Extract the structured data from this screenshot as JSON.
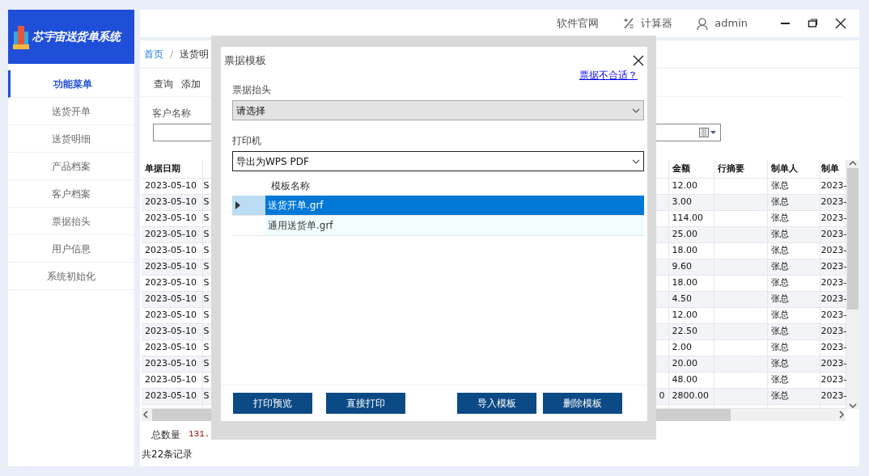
{
  "app": {
    "title": "芯宇宙送货单系统"
  },
  "sidebar": {
    "items": [
      {
        "label": "功能菜单",
        "selected": true
      },
      {
        "label": "送货开单",
        "selected": false
      },
      {
        "label": "送货明细",
        "selected": false
      },
      {
        "label": "产品档案",
        "selected": false
      },
      {
        "label": "客户档案",
        "selected": false
      },
      {
        "label": "票据抬头",
        "selected": false
      },
      {
        "label": "用户信息",
        "selected": false
      },
      {
        "label": "系统初始化",
        "selected": false
      }
    ]
  },
  "topbar": {
    "links": [
      {
        "kind": "plain",
        "label": "软件官网"
      },
      {
        "kind": "calculator",
        "label": "计算器"
      },
      {
        "kind": "user",
        "label": "admin"
      }
    ]
  },
  "breadcrumb": {
    "items": [
      "首页",
      "送货明"
    ],
    "separator": "/"
  },
  "toolbar": [
    "查询",
    "添加"
  ],
  "filter": {
    "label": "客户名称"
  },
  "table": {
    "columns": [
      "单据日期",
      null,
      null,
      "金额",
      "行摘要",
      "制单人",
      "制单"
    ],
    "rows": [
      [
        "2023-05-10",
        "S",
        null,
        "12.00",
        null,
        "张总",
        "2023-"
      ],
      [
        "2023-05-10",
        "S",
        null,
        "3.00",
        null,
        "张总",
        "2023-"
      ],
      [
        "2023-05-10",
        "S",
        null,
        "114.00",
        null,
        "张总",
        "2023-"
      ],
      [
        "2023-05-10",
        "S",
        null,
        "25.00",
        null,
        "张总",
        "2023-"
      ],
      [
        "2023-05-10",
        "S",
        null,
        "18.00",
        null,
        "张总",
        "2023-"
      ],
      [
        "2023-05-10",
        "S",
        null,
        "9.60",
        null,
        "张总",
        "2023-"
      ],
      [
        "2023-05-10",
        "S",
        null,
        "18.00",
        null,
        "张总",
        "2023-"
      ],
      [
        "2023-05-10",
        "S",
        null,
        "4.50",
        null,
        "张总",
        "2023-"
      ],
      [
        "2023-05-10",
        "S",
        null,
        "12.00",
        null,
        "张总",
        "2023-"
      ],
      [
        "2023-05-10",
        "S",
        null,
        "22.50",
        null,
        "张总",
        "2023-"
      ],
      [
        "2023-05-10",
        "S",
        null,
        "2.00",
        null,
        "张总",
        "2023-"
      ],
      [
        "2023-05-10",
        "S",
        null,
        "20.00",
        null,
        "张总",
        "2023-"
      ],
      [
        "2023-05-10",
        "S",
        null,
        "48.00",
        null,
        "张总",
        "2023-"
      ],
      [
        "2023-05-10",
        "S",
        "0",
        "2800.00",
        null,
        "张总",
        "2023-"
      ]
    ]
  },
  "summary": {
    "label": "总数量",
    "value": "131."
  },
  "record_count": "共22条记录",
  "dialog": {
    "title": "票据模板",
    "help_link": "票据不合适？",
    "header_select": {
      "label": "票据抬头",
      "value": "请选择",
      "disabled": true
    },
    "printer_select": {
      "label": "打印机",
      "value": "导出为WPS PDF",
      "disabled": false
    },
    "templates": {
      "column": "模板名称",
      "rows": [
        {
          "name": "送货开单.grf",
          "selected": true
        },
        {
          "name": "通用送货单.grf",
          "selected": false
        }
      ]
    },
    "buttons": [
      "打印预览",
      "直接打印",
      "导入模板",
      "删除模板"
    ]
  }
}
